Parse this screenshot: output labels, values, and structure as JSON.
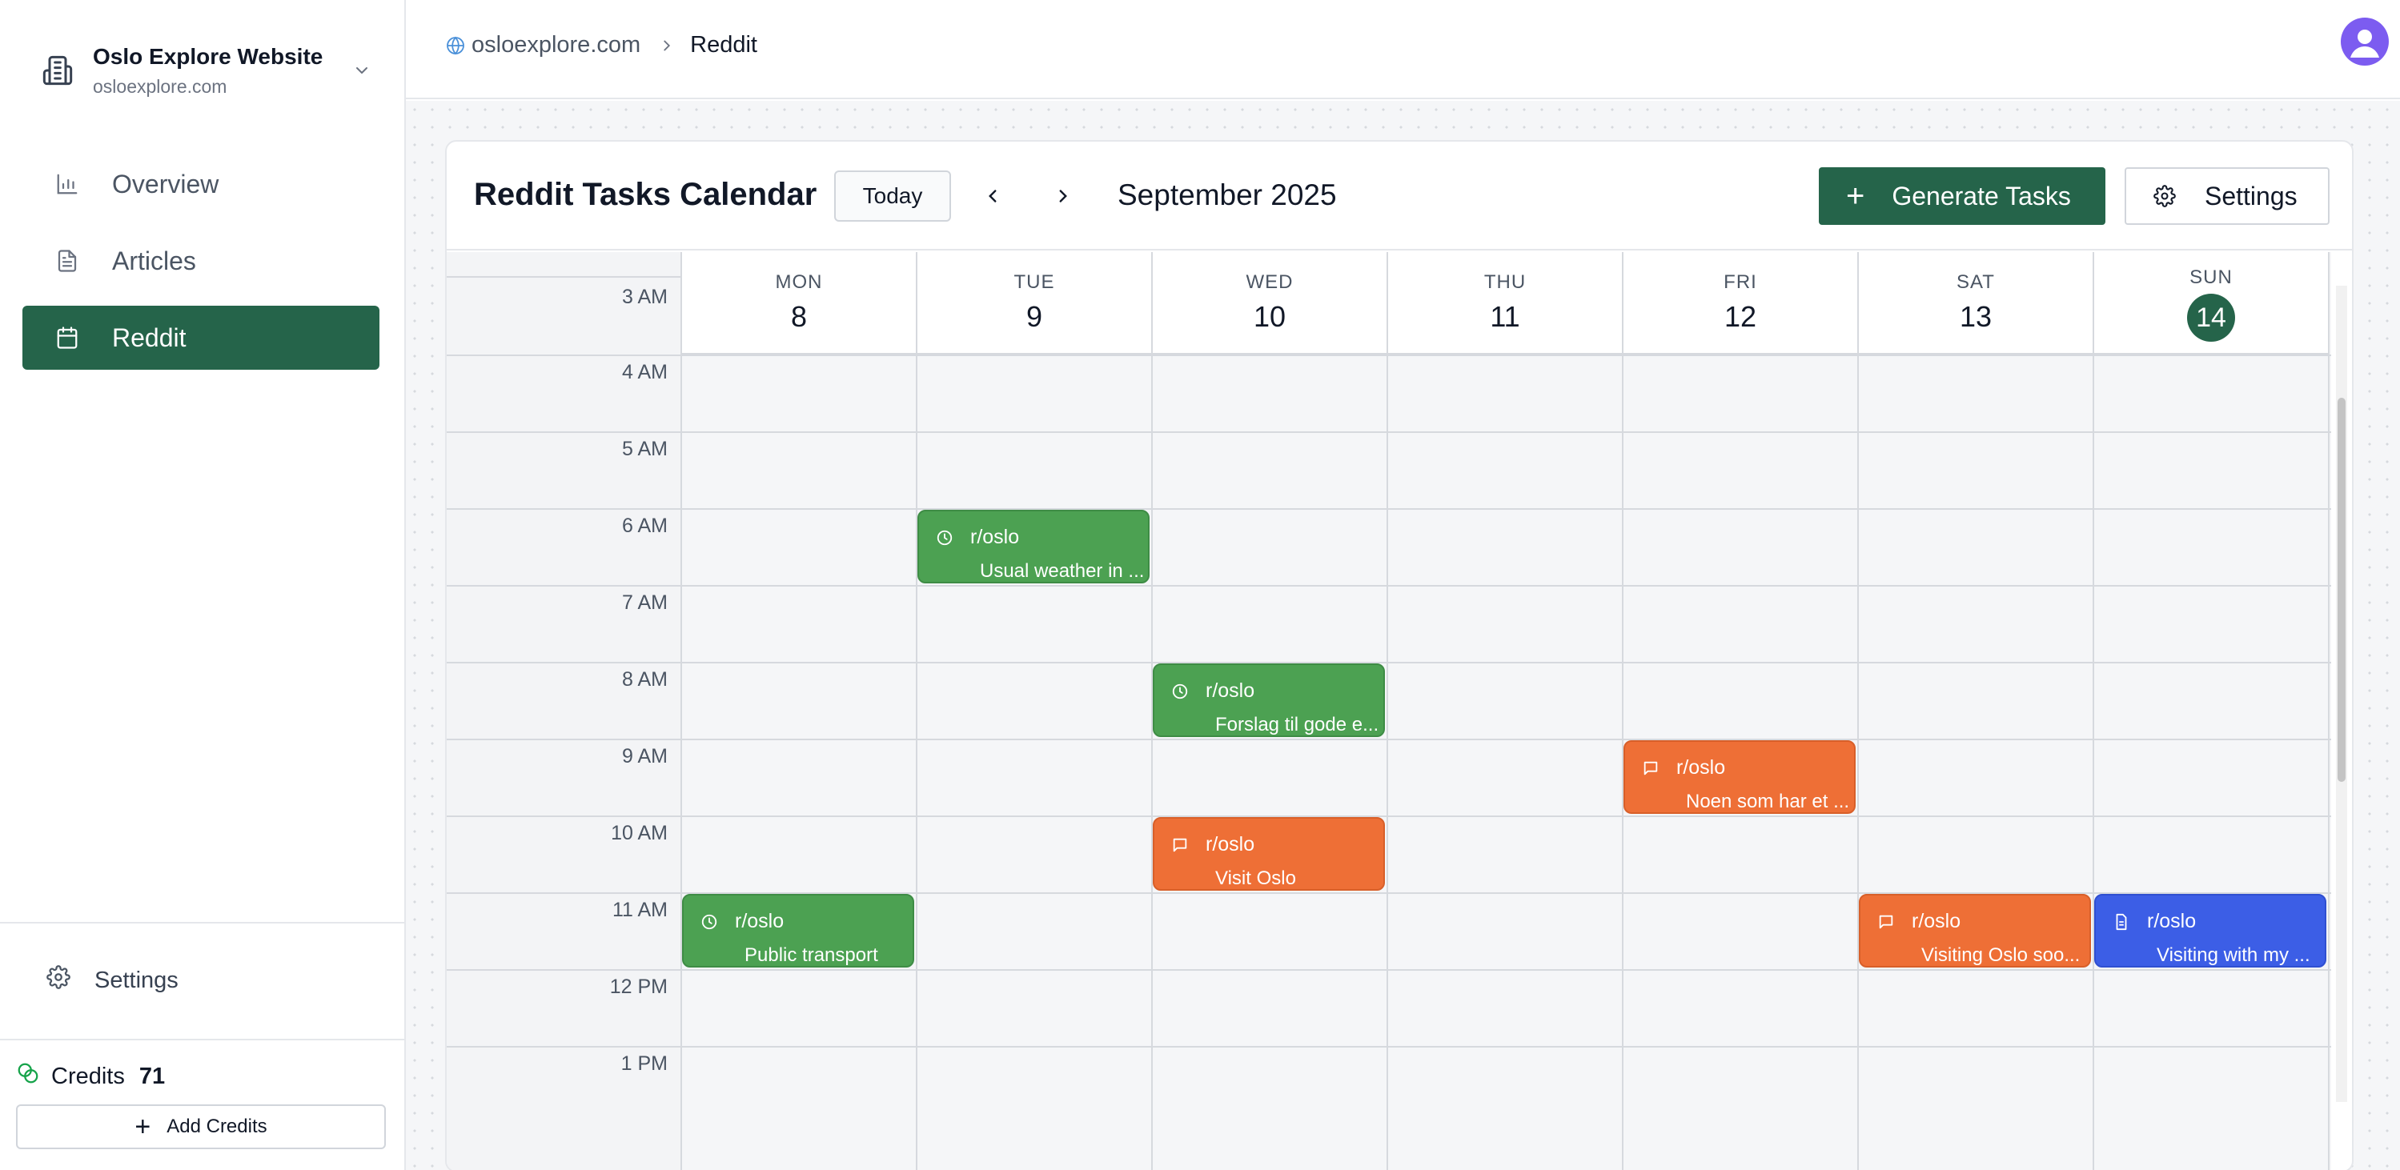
{
  "org": {
    "name": "Oslo Explore Website",
    "url": "osloexplore.com"
  },
  "nav": {
    "items": [
      {
        "label": "Overview",
        "icon": "bar-chart-icon"
      },
      {
        "label": "Articles",
        "icon": "document-icon"
      },
      {
        "label": "Reddit",
        "icon": "calendar-icon",
        "active": true
      }
    ],
    "settings_label": "Settings"
  },
  "credits": {
    "label": "Credits",
    "value": "71",
    "add_label": "Add Credits"
  },
  "breadcrumb": {
    "site": "osloexplore.com",
    "current": "Reddit"
  },
  "calendar": {
    "title": "Reddit Tasks Calendar",
    "today_label": "Today",
    "month": "September 2025",
    "generate_label": "Generate Tasks",
    "settings_label": "Settings",
    "days": [
      {
        "name": "MON",
        "num": "8"
      },
      {
        "name": "TUE",
        "num": "9"
      },
      {
        "name": "WED",
        "num": "10"
      },
      {
        "name": "THU",
        "num": "11"
      },
      {
        "name": "FRI",
        "num": "12"
      },
      {
        "name": "SAT",
        "num": "13"
      },
      {
        "name": "SUN",
        "num": "14",
        "today": true
      }
    ],
    "times": [
      "3 AM",
      "4 AM",
      "5 AM",
      "6 AM",
      "7 AM",
      "8 AM",
      "9 AM",
      "10 AM",
      "11 AM",
      "12 PM",
      "1 PM"
    ],
    "events": [
      {
        "day": "TUE",
        "time": "6 AM",
        "color": "green",
        "icon": "clock-icon",
        "sub": "r/oslo",
        "text": "Usual weather in ..."
      },
      {
        "day": "WED",
        "time": "8 AM",
        "color": "green",
        "icon": "clock-icon",
        "sub": "r/oslo",
        "text": "Forslag til gode e..."
      },
      {
        "day": "FRI",
        "time": "9 AM",
        "color": "orange",
        "icon": "comment-icon",
        "sub": "r/oslo",
        "text": "Noen som har et ..."
      },
      {
        "day": "WED",
        "time": "10 AM",
        "color": "orange",
        "icon": "comment-icon",
        "sub": "r/oslo",
        "text": "Visit Oslo"
      },
      {
        "day": "MON",
        "time": "11 AM",
        "color": "green",
        "icon": "clock-icon",
        "sub": "r/oslo",
        "text": "Public transport"
      },
      {
        "day": "SAT",
        "time": "11 AM",
        "color": "orange",
        "icon": "comment-icon",
        "sub": "r/oslo",
        "text": "Visiting Oslo soo..."
      },
      {
        "day": "SUN",
        "time": "11 AM",
        "color": "blue",
        "icon": "document-icon",
        "sub": "r/oslo",
        "text": "Visiting with my ..."
      }
    ]
  },
  "colors": {
    "brand": "#25644a",
    "green": "#4ca152",
    "orange": "#ee6f36",
    "blue": "#3c5ee6",
    "avatar": "#7c5cf0"
  }
}
